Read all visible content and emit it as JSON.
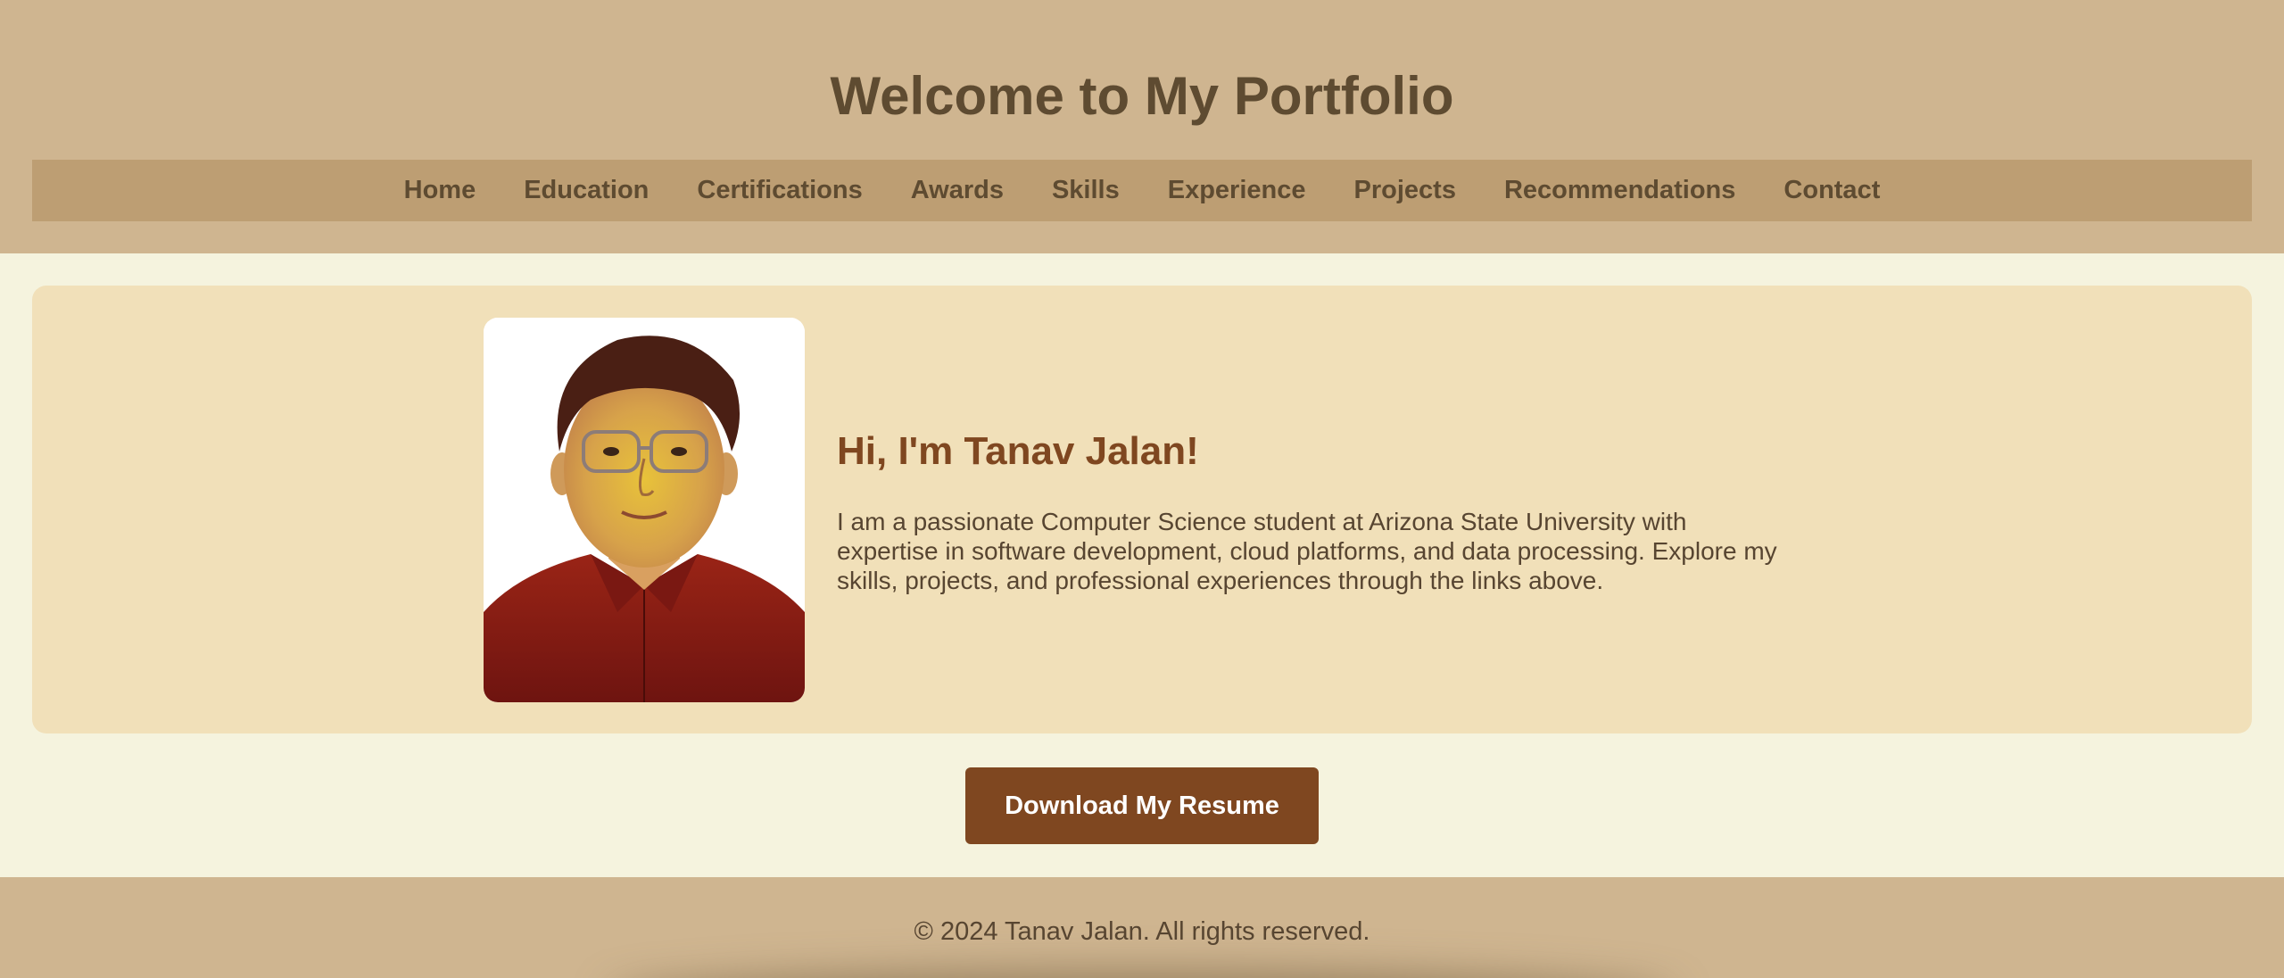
{
  "header": {
    "title": "Welcome to My Portfolio"
  },
  "nav": {
    "items": [
      {
        "label": "Home"
      },
      {
        "label": "Education"
      },
      {
        "label": "Certifications"
      },
      {
        "label": "Awards"
      },
      {
        "label": "Skills"
      },
      {
        "label": "Experience"
      },
      {
        "label": "Projects"
      },
      {
        "label": "Recommendations"
      },
      {
        "label": "Contact"
      }
    ]
  },
  "hero": {
    "heading": "Hi, I'm Tanav Jalan!",
    "bio": "I am a passionate Computer Science student at Arizona State University with expertise in software development, cloud platforms, and data processing. Explore my skills, projects, and professional experiences through the links above."
  },
  "resume_button": {
    "label": "Download My Resume"
  },
  "footer": {
    "text": "© 2024 Tanav Jalan. All rights reserved."
  },
  "colors": {
    "header_bg": "#cfb590",
    "nav_bg": "#bd9e73",
    "page_bg": "#f5f3de",
    "card_bg": "#f1e0b9",
    "accent": "#7f4720",
    "text_dark": "#5e4b31"
  }
}
